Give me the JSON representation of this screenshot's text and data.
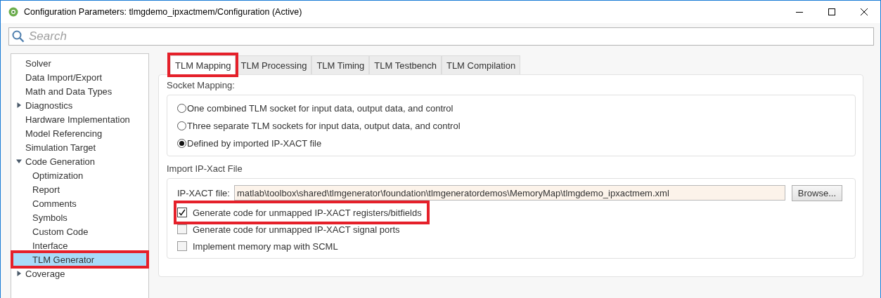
{
  "window": {
    "title": "Configuration Parameters: tlmgdemo_ipxactmem/Configuration (Active)"
  },
  "search": {
    "placeholder": "Search"
  },
  "sidebar": {
    "items": [
      {
        "label": "Solver",
        "selected": false,
        "highlighted": false
      },
      {
        "label": "Data Import/Export",
        "selected": false,
        "highlighted": false
      },
      {
        "label": "Math and Data Types",
        "selected": false,
        "highlighted": false
      },
      {
        "label": "Diagnostics",
        "selected": false,
        "highlighted": false,
        "expanded": false
      },
      {
        "label": "Hardware Implementation",
        "selected": false,
        "highlighted": false
      },
      {
        "label": "Model Referencing",
        "selected": false,
        "highlighted": false
      },
      {
        "label": "Simulation Target",
        "selected": false,
        "highlighted": false
      },
      {
        "label": "Code Generation",
        "selected": false,
        "highlighted": false,
        "expanded": true,
        "children": [
          {
            "label": "Optimization",
            "selected": false,
            "highlighted": false
          },
          {
            "label": "Report",
            "selected": false,
            "highlighted": false
          },
          {
            "label": "Comments",
            "selected": false,
            "highlighted": false
          },
          {
            "label": "Symbols",
            "selected": false,
            "highlighted": false
          },
          {
            "label": "Custom Code",
            "selected": false,
            "highlighted": false
          },
          {
            "label": "Interface",
            "selected": false,
            "highlighted": false
          },
          {
            "label": "TLM Generator",
            "selected": true,
            "highlighted": true
          }
        ]
      },
      {
        "label": "Coverage",
        "selected": false,
        "highlighted": false,
        "expanded": false
      }
    ]
  },
  "tabs": [
    {
      "label": "TLM Mapping",
      "selected": true,
      "highlighted": true
    },
    {
      "label": "TLM Processing",
      "selected": false,
      "highlighted": false
    },
    {
      "label": "TLM Timing",
      "selected": false,
      "highlighted": false
    },
    {
      "label": "TLM Testbench",
      "selected": false,
      "highlighted": false
    },
    {
      "label": "TLM Compilation",
      "selected": false,
      "highlighted": false
    }
  ],
  "socket_mapping": {
    "label": "Socket Mapping:",
    "options": [
      {
        "label": "One combined TLM socket for input data, output data, and control",
        "selected": false
      },
      {
        "label": "Three separate TLM sockets for input data, output data, and control",
        "selected": false
      },
      {
        "label": "Defined by imported IP-XACT file",
        "selected": true
      }
    ]
  },
  "import_file": {
    "label": "Import IP-Xact File",
    "file_label": "IP-XACT file:",
    "file_value": "matlab\\toolbox\\shared\\tlmgenerator\\foundation\\tlmgeneratordemos\\MemoryMap\\tlmgdemo_ipxactmem.xml",
    "browse_button": "Browse...",
    "checkboxes": [
      {
        "label": "Generate code for unmapped IP-XACT registers/bitfields",
        "checked": true,
        "highlighted": true
      },
      {
        "label": "Generate code for unmapped IP-XACT signal ports",
        "checked": false,
        "highlighted": false
      },
      {
        "label": "Implement memory map with SCML",
        "checked": false,
        "highlighted": false
      }
    ]
  }
}
